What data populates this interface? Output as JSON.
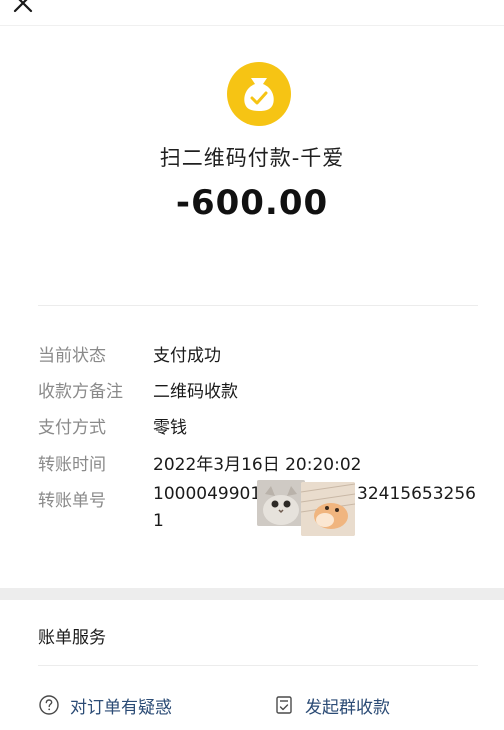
{
  "header": {
    "close_icon": "close-icon"
  },
  "summary": {
    "badge_icon": "money-bag-check-icon",
    "badge_color": "#f6c414",
    "title": "扫二维码付款-千爱",
    "amount": "-600.00"
  },
  "details": [
    {
      "label": "当前状态",
      "value": "支付成功"
    },
    {
      "label": "收款方备注",
      "value": "二维码收款"
    },
    {
      "label": "支付方式",
      "value": "零钱"
    },
    {
      "label": "转账时间",
      "value": "2022年3月16日 20:20:02"
    }
  ],
  "transaction": {
    "label": "转账单号",
    "value_part1": "1000049901",
    "value_part2": "32415653256",
    "value_part3": "1",
    "stickers": [
      "cat-sticker",
      "hamster-sticker"
    ]
  },
  "bill_service": {
    "title": "账单服务",
    "links": [
      {
        "label": "对订单有疑惑",
        "icon": "question-circle-icon"
      },
      {
        "label": "发起群收款",
        "icon": "document-check-icon"
      }
    ],
    "link_color": "#2b4b75"
  }
}
